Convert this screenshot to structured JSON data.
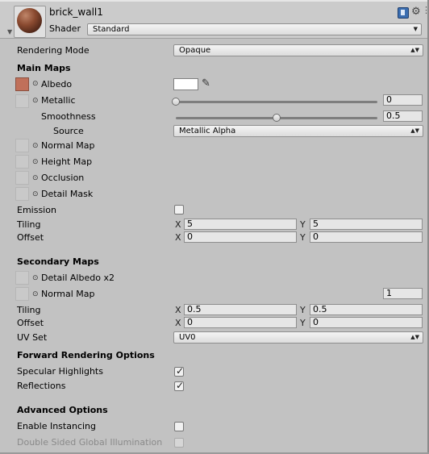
{
  "header": {
    "material_name": "brick_wall1",
    "shader_label": "Shader",
    "shader_value": "Standard"
  },
  "rendering_mode": {
    "label": "Rendering Mode",
    "value": "Opaque"
  },
  "main_maps": {
    "heading": "Main Maps",
    "albedo": {
      "label": "Albedo",
      "color": "#ffffff"
    },
    "metallic": {
      "label": "Metallic",
      "value": "0",
      "slider_fraction": 0.0
    },
    "smoothness": {
      "label": "Smoothness",
      "value": "0.5",
      "slider_fraction": 0.5
    },
    "source": {
      "label": "Source",
      "value": "Metallic Alpha"
    },
    "normal_map": "Normal Map",
    "height_map": "Height Map",
    "occlusion": "Occlusion",
    "detail_mask": "Detail Mask",
    "emission": "Emission",
    "tiling": {
      "label": "Tiling",
      "x": "5",
      "y": "5"
    },
    "offset": {
      "label": "Offset",
      "x": "0",
      "y": "0"
    }
  },
  "secondary_maps": {
    "heading": "Secondary Maps",
    "detail_albedo": "Detail Albedo x2",
    "normal_map": {
      "label": "Normal Map",
      "value": "1"
    },
    "tiling": {
      "label": "Tiling",
      "x": "0.5",
      "y": "0.5"
    },
    "offset": {
      "label": "Offset",
      "x": "0",
      "y": "0"
    },
    "uv_set": {
      "label": "UV Set",
      "value": "UV0"
    }
  },
  "forward_rendering": {
    "heading": "Forward Rendering Options",
    "specular_highlights": {
      "label": "Specular Highlights",
      "checked": true
    },
    "reflections": {
      "label": "Reflections",
      "checked": true
    }
  },
  "advanced": {
    "heading": "Advanced Options",
    "enable_instancing": {
      "label": "Enable Instancing",
      "checked": false
    },
    "double_sided_gi": {
      "label": "Double Sided Global Illumination",
      "checked": false
    }
  },
  "axis_labels": {
    "x": "X",
    "y": "Y"
  },
  "icons": {
    "foldout": "▼",
    "dropdown_arrow": "▲▼",
    "picker": "⊙",
    "eyedropper": "✎",
    "gear": "⚙",
    "menu": "⋮"
  }
}
